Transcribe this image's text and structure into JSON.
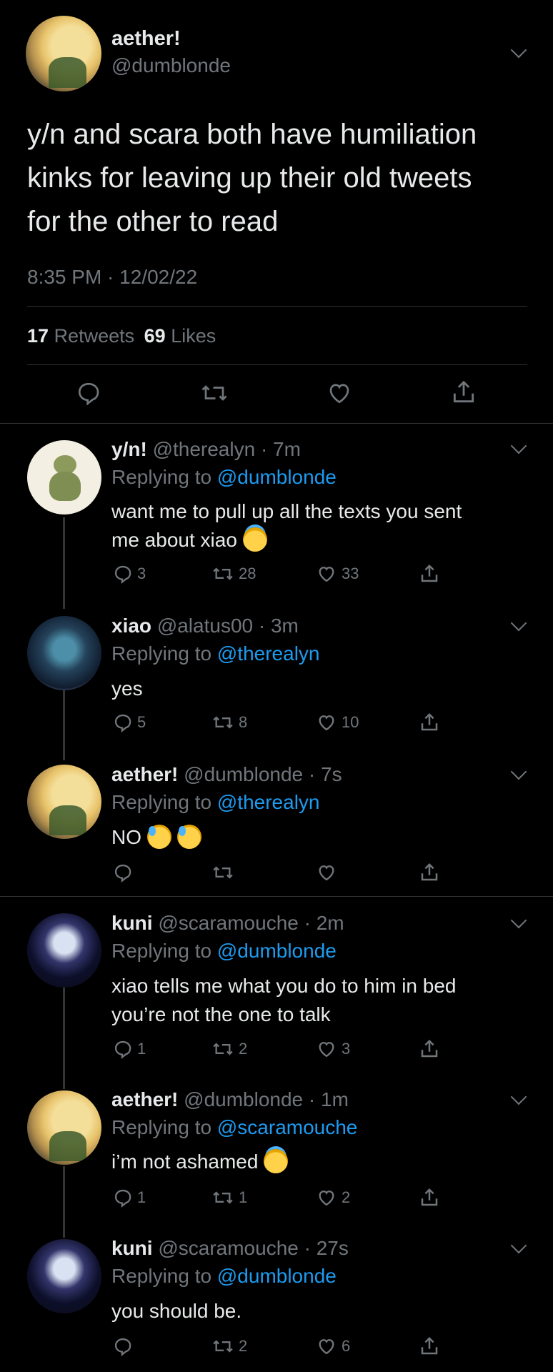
{
  "main_tweet": {
    "display_name": "aether!",
    "handle": "@dumblonde",
    "text_lines": [
      "y/n and scara both have humiliation",
      "kinks for leaving up their old tweets",
      "for the other to read"
    ],
    "timestamp": "8:35 PM · 12/02/22",
    "retweets_count": "17",
    "retweets_label": "Retweets",
    "likes_count": "69",
    "likes_label": "Likes"
  },
  "replies": [
    {
      "display_name": "y/n!",
      "meta": "@therealyn · 7m",
      "replying_prefix": "Replying to",
      "replying_to": "@dumblonde",
      "text_lines": [
        "want me to pull up all the texts you sent",
        "me about xiao"
      ],
      "emoji": [
        "smiling-face-with-halo"
      ],
      "reply_count": "3",
      "retweet_count": "28",
      "like_count": "33"
    },
    {
      "display_name": "xiao",
      "meta": "@alatus00 · 3m",
      "replying_prefix": "Replying to",
      "replying_to": "@therealyn",
      "text_lines": [
        "yes"
      ],
      "emoji": [],
      "reply_count": "5",
      "retweet_count": "8",
      "like_count": "10"
    },
    {
      "display_name": "aether!",
      "meta": "@dumblonde · 7s",
      "replying_prefix": "Replying to",
      "replying_to": "@therealyn",
      "text_lines": [
        "NO"
      ],
      "emoji": [
        "downcast-face-with-sweat",
        "downcast-face-with-sweat"
      ],
      "reply_count": "",
      "retweet_count": "",
      "like_count": ""
    },
    {
      "display_name": "kuni",
      "meta": "@scaramouche · 2m",
      "replying_prefix": "Replying to",
      "replying_to": "@dumblonde",
      "text_lines": [
        "xiao tells me what you do to him in bed",
        "you’re not the one to talk"
      ],
      "emoji": [],
      "reply_count": "1",
      "retweet_count": "2",
      "like_count": "3"
    },
    {
      "display_name": "aether!",
      "meta": "@dumblonde · 1m",
      "replying_prefix": "Replying to",
      "replying_to": "@scaramouche",
      "text_lines": [
        "i’m not ashamed"
      ],
      "emoji": [
        "smiling-face-with-halo"
      ],
      "reply_count": "1",
      "retweet_count": "1",
      "like_count": "2"
    },
    {
      "display_name": "kuni",
      "meta": "@scaramouche · 27s",
      "replying_prefix": "Replying to",
      "replying_to": "@dumblonde",
      "text_lines": [
        "you should be."
      ],
      "emoji": [],
      "reply_count": "",
      "retweet_count": "2",
      "like_count": "6"
    }
  ],
  "icons": [
    "reply-icon",
    "retweet-icon",
    "like-icon",
    "share-icon",
    "chevron-down-icon"
  ],
  "colors": {
    "background": "#000000",
    "text": "#e7e9ea",
    "muted": "#71767b",
    "link": "#1d9bf0",
    "divider": "#2f3336"
  }
}
